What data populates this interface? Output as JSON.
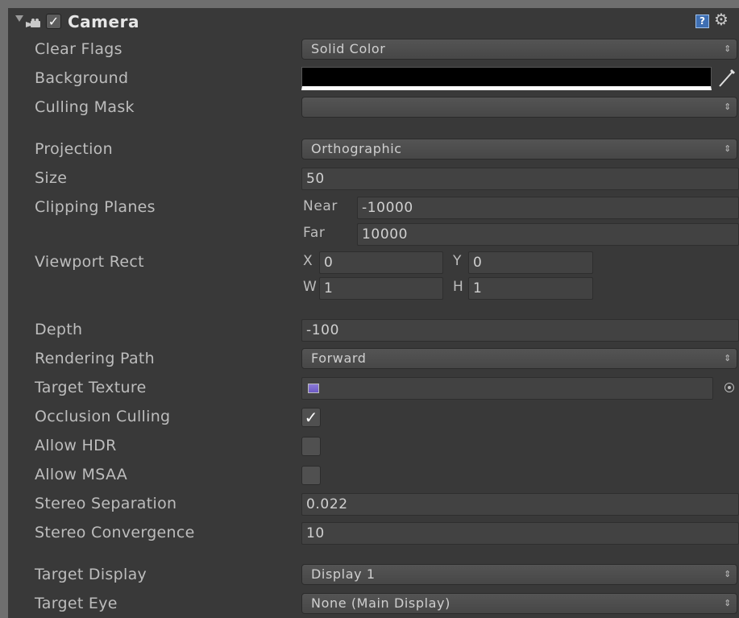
{
  "header": {
    "title": "Camera",
    "enabled_check": "✓",
    "help_icon_text": "?"
  },
  "fields": {
    "clear_flags": {
      "label": "Clear Flags",
      "value": "Solid Color"
    },
    "background": {
      "label": "Background",
      "color": "#000000"
    },
    "culling_mask": {
      "label": "Culling Mask",
      "value": ""
    },
    "projection": {
      "label": "Projection",
      "value": "Orthographic"
    },
    "size": {
      "label": "Size",
      "value": "50"
    },
    "clipping_planes": {
      "label": "Clipping Planes",
      "near_label": "Near",
      "near_value": "-10000",
      "far_label": "Far",
      "far_value": "10000"
    },
    "viewport_rect": {
      "label": "Viewport Rect",
      "x_label": "X",
      "x_value": "0",
      "y_label": "Y",
      "y_value": "0",
      "w_label": "W",
      "w_value": "1",
      "h_label": "H",
      "h_value": "1"
    },
    "depth": {
      "label": "Depth",
      "value": "-100"
    },
    "rendering_path": {
      "label": "Rendering Path",
      "value": "Forward"
    },
    "target_texture": {
      "label": "Target Texture",
      "value": ""
    },
    "occlusion_culling": {
      "label": "Occlusion Culling",
      "checked": true,
      "check": "✓"
    },
    "allow_hdr": {
      "label": "Allow HDR",
      "checked": false
    },
    "allow_msaa": {
      "label": "Allow MSAA",
      "checked": false
    },
    "stereo_separation": {
      "label": "Stereo Separation",
      "value": "0.022"
    },
    "stereo_convergence": {
      "label": "Stereo Convergence",
      "value": "10"
    },
    "target_display": {
      "label": "Target Display",
      "value": "Display 1"
    },
    "target_eye": {
      "label": "Target Eye",
      "value": "None (Main Display)"
    }
  },
  "colors": {
    "panel_bg": "#393939",
    "outer_bg": "#6f6f6f",
    "field_bg": "#424242",
    "help_blue": "#3e6fb3"
  },
  "icons": {
    "foldout": "triangle-down-icon",
    "camera": "camera-icon",
    "help": "help-icon",
    "settings": "gear-icon",
    "eyedropper": "eyedropper-icon",
    "object_picker": "object-picker-icon",
    "texture": "render-texture-icon",
    "dropdown_arrow": "updown-arrow-icon"
  }
}
